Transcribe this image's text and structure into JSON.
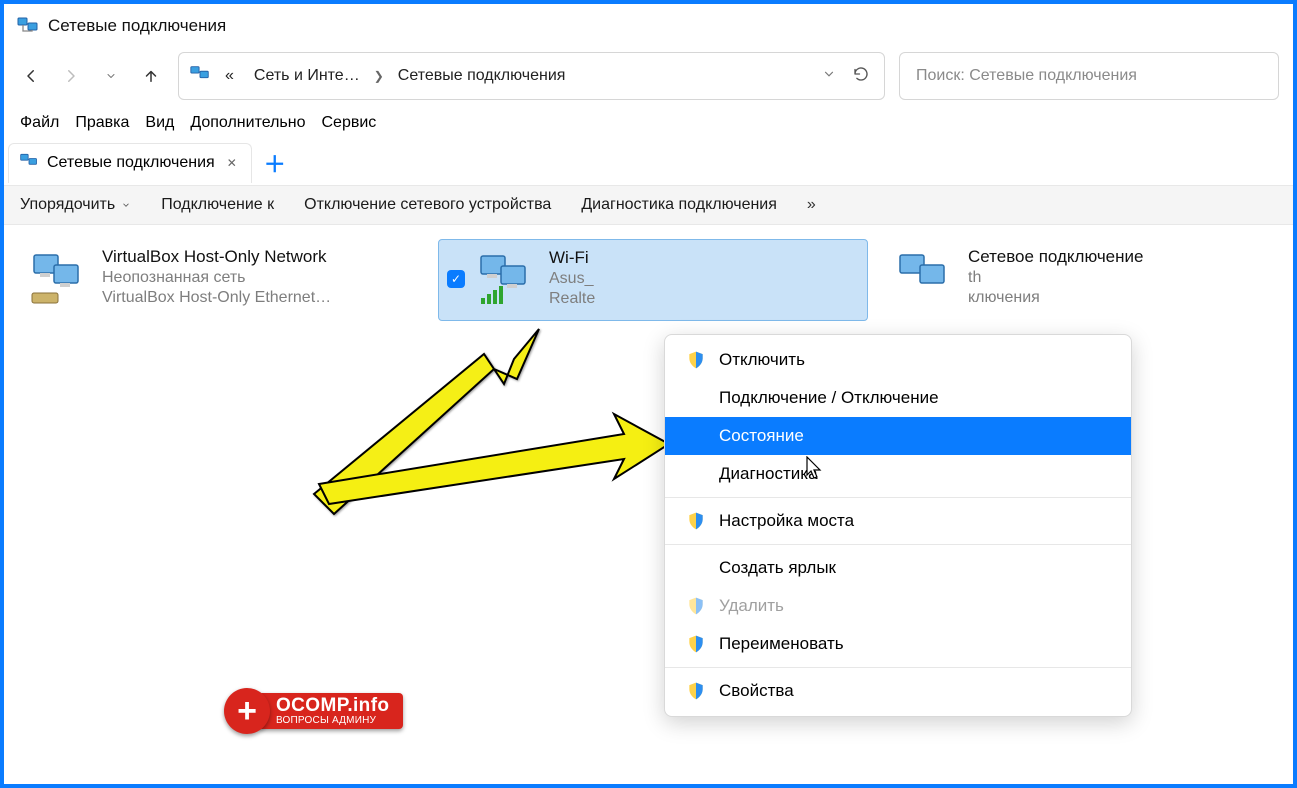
{
  "window": {
    "title": "Сетевые подключения"
  },
  "breadcrumb": {
    "seg1": "Сеть и Инте…",
    "seg2": "Сетевые подключения"
  },
  "search": {
    "placeholder": "Поиск: Сетевые подключения"
  },
  "menu": {
    "file": "Файл",
    "edit": "Правка",
    "view": "Вид",
    "extra": "Дополнительно",
    "service": "Сервис"
  },
  "tab": {
    "label": "Сетевые подключения"
  },
  "toolbar": {
    "organize": "Упорядочить",
    "connect_to": "Подключение к",
    "disable_device": "Отключение сетевого устройства",
    "diagnose": "Диагностика подключения",
    "overflow": "»"
  },
  "connections": [
    {
      "name": "VirtualBox Host-Only Network",
      "sub1": "Неопознанная сеть",
      "sub2": "VirtualBox Host-Only Ethernet…"
    },
    {
      "name": "Wi-Fi",
      "sub1": "Asus_",
      "sub2": "Realte"
    },
    {
      "name": "Сетевое подключение",
      "sub1": "th",
      "sub2": "ключения"
    }
  ],
  "context_menu": {
    "disable": "Отключить",
    "connect_disconnect": "Подключение / Отключение",
    "status": "Состояние",
    "diagnose": "Диагностика",
    "bridge": "Настройка моста",
    "shortcut": "Создать ярлык",
    "delete": "Удалить",
    "rename": "Переименовать",
    "properties": "Свойства"
  },
  "logo": {
    "main": "OCOMP.info",
    "sub": "ВОПРОСЫ АДМИНУ"
  }
}
